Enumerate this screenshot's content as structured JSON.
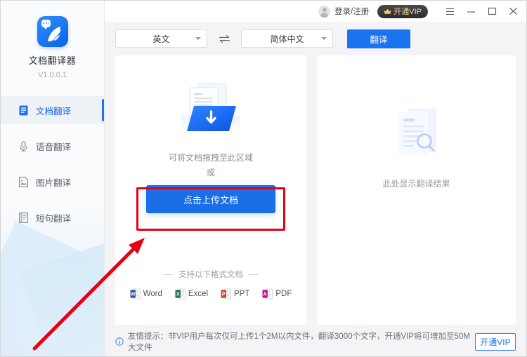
{
  "app": {
    "name": "文档翻译器",
    "version": "V1.0.0.1",
    "logo_icon": "dove-logo-icon"
  },
  "sidebar": {
    "items": [
      {
        "label": "文档翻译",
        "icon": "document-translate-icon",
        "active": true
      },
      {
        "label": "语音翻译",
        "icon": "microphone-icon",
        "active": false
      },
      {
        "label": "图片翻译",
        "icon": "image-icon",
        "active": false
      },
      {
        "label": "短句翻译",
        "icon": "text-lines-icon",
        "active": false
      }
    ]
  },
  "titlebar": {
    "account_label": "登录/注册",
    "account_icon": "user-avatar-icon",
    "vip_label": "开通VIP",
    "vip_icon": "crown-icon",
    "menu_icon": "hamburger-menu-icon",
    "minimize_icon": "minimize-icon",
    "maximize_icon": "maximize-icon",
    "close_icon": "close-icon"
  },
  "toolbar": {
    "source_language": "英文",
    "target_language": "简体中文",
    "swap_icon": "swap-arrows-icon",
    "translate_label": "翻译",
    "dropdown_icon": "chevron-down-icon"
  },
  "upload_panel": {
    "illustration_icon": "document-upload-illustration",
    "drop_hint": "可将文档拖拽至此区域",
    "or_label": "或",
    "upload_button_label": "点击上传文档",
    "formats_title": "支持以下格式文档",
    "formats": [
      {
        "label": "Word",
        "icon": "word-file-icon",
        "color": "#2b579a"
      },
      {
        "label": "Excel",
        "icon": "excel-file-icon",
        "color": "#217346"
      },
      {
        "label": "PPT",
        "icon": "powerpoint-file-icon",
        "color": "#d24726"
      },
      {
        "label": "PDF",
        "icon": "pdf-file-icon",
        "color": "#b5179e"
      }
    ]
  },
  "result_panel": {
    "illustration_icon": "document-search-illustration",
    "placeholder": "此处显示翻译结果"
  },
  "footer": {
    "info_icon": "info-circle-icon",
    "notice": "友情提示：非VIP用户每次仅可上传1个2M以内文件，翻译3000个文字，开通VIP将可增加至50M大文件",
    "vip_button_label": "开通VIP"
  },
  "annotations": {
    "highlight_color": "#e60012",
    "arrow_color": "#e60012",
    "highlight_target": "点击上传文档"
  },
  "colors": {
    "accent": "#1a73f0",
    "vip_dark": "#2c2c2e",
    "vip_gold": "#f4d79a",
    "sidebar_bg": "#fafbfc",
    "workspace_bg": "#f4f4f6"
  }
}
